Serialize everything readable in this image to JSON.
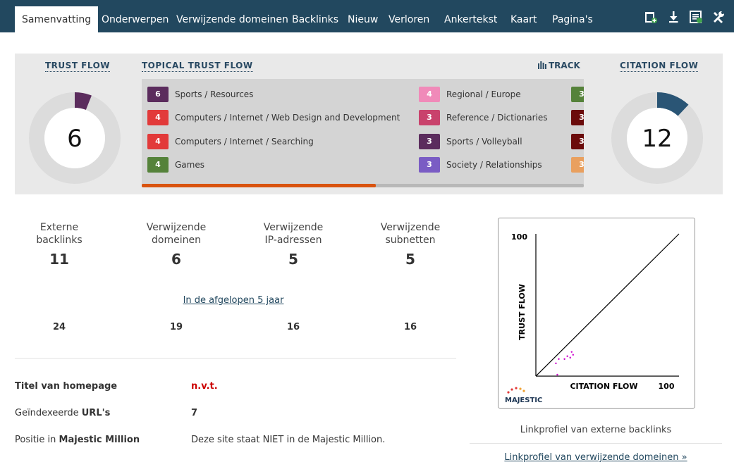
{
  "nav": {
    "tabs": [
      "Samenvatting",
      "Onderwerpen",
      "Verwijzende domeinen",
      "Backlinks",
      "Nieuw",
      "Verloren",
      "Ankertekst",
      "Kaart",
      "Pagina's"
    ],
    "active_tab": "Samenvatting",
    "tools": [
      "add-bucket-icon",
      "download-icon",
      "report-icon",
      "tools-icon"
    ]
  },
  "trust_flow": {
    "label": "TRUST FLOW",
    "value": "6",
    "fraction": 0.06,
    "color": "#5b2c5d"
  },
  "citation_flow": {
    "label": "CITATION FLOW",
    "value": "12",
    "fraction": 0.12,
    "color": "#2a5575"
  },
  "topical": {
    "label": "TOPICAL TRUST FLOW",
    "track_label": "TRACK",
    "scroll_fraction": 0.53,
    "topics": [
      {
        "score": "6",
        "label": "Sports / Resources",
        "color": "#5b2c5d"
      },
      {
        "score": "4",
        "label": "Computers / Internet / Web Design and Development",
        "color": "#e23a3a"
      },
      {
        "score": "4",
        "label": "Computers / Internet / Searching",
        "color": "#e23a3a"
      },
      {
        "score": "4",
        "label": "Games",
        "color": "#55823a"
      },
      {
        "score": "4",
        "label": "Regional / Europe",
        "color": "#f08ab9"
      },
      {
        "score": "3",
        "label": "Reference / Dictionaries",
        "color": "#c9426c"
      },
      {
        "score": "3",
        "label": "Sports / Volleyball",
        "color": "#5b2c5d"
      },
      {
        "score": "3",
        "label": "Society / Relationships",
        "color": "#7a5cc4"
      },
      {
        "score": "3",
        "label": "",
        "color": "#55823a"
      },
      {
        "score": "3",
        "label": "",
        "color": "#6b0c0c"
      },
      {
        "score": "3",
        "label": "",
        "color": "#6b0c0c"
      },
      {
        "score": "3",
        "label": "",
        "color": "#e9a05f"
      }
    ]
  },
  "stats": [
    {
      "label_1": "Externe",
      "label_2": "backlinks",
      "value": "11",
      "history": "24"
    },
    {
      "label_1": "Verwijzende",
      "label_2": "domeinen",
      "value": "6",
      "history": "19"
    },
    {
      "label_1": "Verwijzende",
      "label_2": "IP-adressen",
      "value": "5",
      "history": "16"
    },
    {
      "label_1": "Verwijzende",
      "label_2": "subnetten",
      "value": "5",
      "history": "16"
    }
  ],
  "history_link": "In de afgelopen 5 jaar",
  "info": {
    "homepage_title_label": "Titel van homepage",
    "homepage_title_value": "n.v.t.",
    "indexed_label_1": "Geïndexeerde",
    "indexed_label_2": "URL's",
    "indexed_value": "7",
    "million_label_1": "Positie in",
    "million_label_2": "Majestic Million",
    "million_value": "Deze site staat NIET in de Majestic Million."
  },
  "chart_data": {
    "type": "scatter",
    "xlabel": "CITATION FLOW",
    "ylabel": "TRUST FLOW",
    "xlim": [
      0,
      100
    ],
    "ylim": [
      0,
      100
    ],
    "x_max_label": "100",
    "y_max_label": "100",
    "diagonal": true,
    "logo": "MAJESTIC",
    "point_color": "#cc00cc",
    "points": [
      {
        "x": 14,
        "y": 9
      },
      {
        "x": 16,
        "y": 12
      },
      {
        "x": 20,
        "y": 12
      },
      {
        "x": 22,
        "y": 14
      },
      {
        "x": 24,
        "y": 13
      },
      {
        "x": 25,
        "y": 17
      },
      {
        "x": 26,
        "y": 15
      },
      {
        "x": 15,
        "y": 1
      }
    ]
  },
  "chart_caption": "Linkprofiel van externe backlinks",
  "domains_link": "Linkprofiel van verwijzende domeinen »"
}
